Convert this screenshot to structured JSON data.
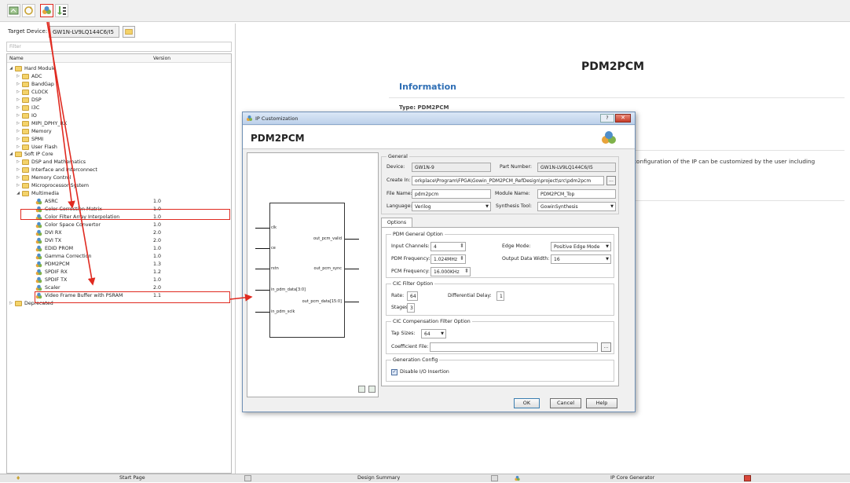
{
  "toolbar": {
    "buttons": [
      "ip-core-generator-icon",
      "refresh-icon",
      "ip-customize-icon",
      "import-icon"
    ]
  },
  "target": {
    "label": "Target Device:",
    "value": "GW1N-LV9LQ144C6/I5"
  },
  "filter": {
    "placeholder": "Filter"
  },
  "tree": {
    "col_name": "Name",
    "col_version": "Version",
    "rows": [
      {
        "label": "Hard Module",
        "level": 0,
        "type": "folder",
        "expanded": true,
        "version": ""
      },
      {
        "label": "ADC",
        "level": 1,
        "type": "folder",
        "expanded": false,
        "version": ""
      },
      {
        "label": "BandGap",
        "level": 1,
        "type": "folder",
        "expanded": false,
        "version": ""
      },
      {
        "label": "CLOCK",
        "level": 1,
        "type": "folder",
        "expanded": false,
        "version": ""
      },
      {
        "label": "DSP",
        "level": 1,
        "type": "folder",
        "expanded": false,
        "version": ""
      },
      {
        "label": "I3C",
        "level": 1,
        "type": "folder",
        "expanded": false,
        "version": ""
      },
      {
        "label": "IO",
        "level": 1,
        "type": "folder",
        "expanded": false,
        "version": ""
      },
      {
        "label": "MIPI_DPHY_RX",
        "level": 1,
        "type": "folder",
        "expanded": false,
        "version": ""
      },
      {
        "label": "Memory",
        "level": 1,
        "type": "folder",
        "expanded": false,
        "version": ""
      },
      {
        "label": "SPMI",
        "level": 1,
        "type": "folder",
        "expanded": false,
        "version": ""
      },
      {
        "label": "User Flash",
        "level": 1,
        "type": "folder",
        "expanded": false,
        "version": ""
      },
      {
        "label": "Soft IP Core",
        "level": 0,
        "type": "folder",
        "expanded": true,
        "version": ""
      },
      {
        "label": "DSP and Mathematics",
        "level": 1,
        "type": "folder",
        "expanded": false,
        "version": ""
      },
      {
        "label": "Interface and Interconnect",
        "level": 1,
        "type": "folder",
        "expanded": false,
        "version": ""
      },
      {
        "label": "Memory Control",
        "level": 1,
        "type": "folder",
        "expanded": false,
        "version": ""
      },
      {
        "label": "Microprocessor System",
        "level": 1,
        "type": "folder",
        "expanded": false,
        "version": ""
      },
      {
        "label": "Multimedia",
        "level": 1,
        "type": "folder",
        "expanded": true,
        "version": ""
      },
      {
        "label": "ASRC",
        "level": 2,
        "type": "ip",
        "version": "1.0"
      },
      {
        "label": "Color Correction Matrix",
        "level": 2,
        "type": "ip",
        "version": "1.0"
      },
      {
        "label": "Color Filter Array Interpolation",
        "level": 2,
        "type": "ip",
        "version": "1.0"
      },
      {
        "label": "Color Space Convertor",
        "level": 2,
        "type": "ip",
        "version": "1.0"
      },
      {
        "label": "DVI RX",
        "level": 2,
        "type": "ip",
        "version": "2.0"
      },
      {
        "label": "DVI TX",
        "level": 2,
        "type": "ip",
        "version": "2.0"
      },
      {
        "label": "EDID PROM",
        "level": 2,
        "type": "ip",
        "version": "1.0"
      },
      {
        "label": "Gamma Correction",
        "level": 2,
        "type": "ip",
        "version": "1.0"
      },
      {
        "label": "PDM2PCM",
        "level": 2,
        "type": "ip",
        "version": "1.3"
      },
      {
        "label": "SPDIF RX",
        "level": 2,
        "type": "ip",
        "version": "1.2"
      },
      {
        "label": "SPDIF TX",
        "level": 2,
        "type": "ip",
        "version": "1.0"
      },
      {
        "label": "Scaler",
        "level": 2,
        "type": "ip",
        "version": "2.0"
      },
      {
        "label": "Video Frame Buffer with PSRAM",
        "level": 2,
        "type": "ip",
        "version": "1.1"
      },
      {
        "label": "Deprecated",
        "level": 0,
        "type": "folder",
        "expanded": false,
        "version": ""
      }
    ]
  },
  "doc": {
    "title": "PDM2PCM",
    "info_heading": "Information",
    "type_line": "Type: PDM2PCM",
    "desc_fragment": "configuration of the IP can be customized by the user including"
  },
  "dialog": {
    "title": "IP Customization",
    "heading": "PDM2PCM",
    "general": {
      "group_title": "General",
      "device_label": "Device:",
      "device_value": "GW1N-9",
      "part_label": "Part Number:",
      "part_value": "GW1N-LV9LQ144C6/I5",
      "create_label": "Create In:",
      "create_value": "orkplace\\Program\\FPGA\\Gowin_PDM2PCM_RefDesign\\project\\src\\pdm2pcm",
      "browse_label": "...",
      "file_label": "File Name:",
      "file_value": "pdm2pcm",
      "module_label": "Module Name:",
      "module_value": "PDM2PCM_Top",
      "language_label": "Language:",
      "language_value": "Verilog",
      "synthesis_label": "Synthesis Tool:",
      "synthesis_value": "GowinSynthesis"
    },
    "symbol": {
      "inputs": [
        "clk",
        "ce",
        "rstn",
        "in_pdm_data[3:0]",
        "in_pdm_sclk"
      ],
      "outputs": [
        "out_pcm_valid",
        "out_pcm_sync",
        "out_pcm_data[15:0]"
      ]
    },
    "options_tab": "Options",
    "pdm": {
      "group_title": "PDM General Option",
      "input_channels_label": "Input Channels:",
      "input_channels_value": "4",
      "edge_label": "Edge Mode:",
      "edge_value": "Positive Edge Mode",
      "pdm_freq_label": "PDM Frequency:",
      "pdm_freq_value": "1.024MHz",
      "out_width_label": "Output Data Width:",
      "out_width_value": "16",
      "pcm_freq_label": "PCM Frequency:",
      "pcm_freq_value": "16.000KHz"
    },
    "cic": {
      "group_title": "CIC Filter Option",
      "rate_label": "Rate:",
      "rate_value": "64",
      "delay_label": "Differential Delay:",
      "delay_value": "1",
      "stages_label": "Stages:",
      "stages_value": "3"
    },
    "comp": {
      "group_title": "CIC Compensation Filter Option",
      "tap_label": "Tap Sizes:",
      "tap_value": "64",
      "coef_label": "Coefficient File:",
      "coef_value": "",
      "browse_label": "..."
    },
    "gen": {
      "group_title": "Generation Config",
      "disable_io_label": "Disable I/O Insertion",
      "disable_io_checked": true
    },
    "buttons": {
      "ok": "OK",
      "cancel": "Cancel",
      "help": "Help"
    }
  },
  "statusbar": {
    "tabs": [
      "Start Page",
      "Design Summary",
      "IP Core Generator"
    ]
  },
  "colors": {
    "highlight_red": "#e02a20",
    "info_blue": "#2f6fb5",
    "folder_yellow": "#f4d36a"
  }
}
